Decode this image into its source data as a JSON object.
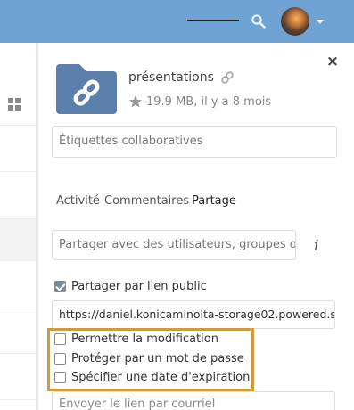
{
  "header": {
    "background": "#6fa3d3",
    "search_icon": "search-icon",
    "avatar_icon": "avatar",
    "menu_caret_icon": "caret-down-icon"
  },
  "left_panel": {
    "view_icon": "grid-view-icon"
  },
  "sidebar": {
    "close_label": "×",
    "file": {
      "name": "présentations",
      "icon": "shared-folder-link-icon",
      "link_icon": "link-icon",
      "star_icon": "star-icon",
      "meta": "19.9 MB, il y a 8 mois"
    },
    "tags_placeholder": "Étiquettes collaboratives",
    "tabs": [
      {
        "label": "Activité",
        "active": false
      },
      {
        "label": "Commentaires",
        "active": false
      },
      {
        "label": "Partage",
        "active": true
      }
    ],
    "sharing": {
      "share_placeholder": "Partager avec des utilisateurs, groupes ou u",
      "info_label": "i",
      "public_link_label": "Partager par lien public",
      "public_link_checked": true,
      "public_url": "https://daniel.konicaminolta-storage02.powered.s",
      "options": [
        {
          "label": "Permettre la modification",
          "checked": false
        },
        {
          "label": "Protéger par un mot de passe",
          "checked": false
        },
        {
          "label": "Spécifier une date d'expiration",
          "checked": false
        }
      ],
      "email_placeholder": "Envoyer le lien par courriel"
    },
    "highlight_color": "#d09b3a"
  }
}
